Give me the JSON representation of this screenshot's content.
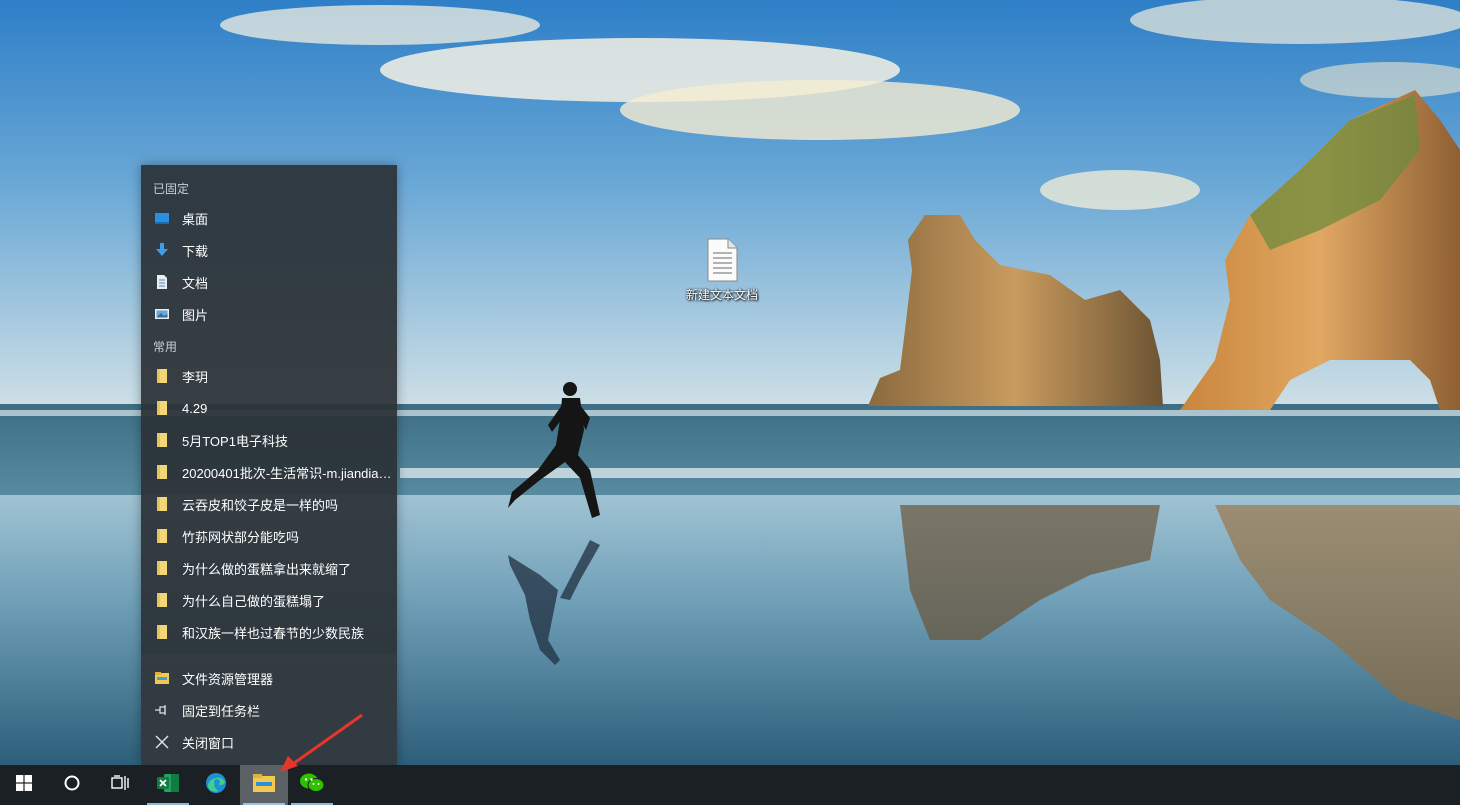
{
  "desktop": {
    "icons": [
      {
        "label": "新建文本文档",
        "icon": "text-document-icon"
      }
    ]
  },
  "jumplist": {
    "pinned_title": "已固定",
    "pinned": [
      {
        "label": "桌面",
        "icon": "desktop-icon"
      },
      {
        "label": "下载",
        "icon": "download-icon"
      },
      {
        "label": "文档",
        "icon": "documents-icon"
      },
      {
        "label": "图片",
        "icon": "pictures-icon"
      }
    ],
    "frequent_title": "常用",
    "frequent": [
      {
        "label": "李玥",
        "icon": "folder-icon"
      },
      {
        "label": "4.29",
        "icon": "folder-icon"
      },
      {
        "label": "5月TOP1电子科技",
        "icon": "folder-icon"
      },
      {
        "label": "20200401批次-生活常识-m.jiandiao....",
        "icon": "folder-icon"
      },
      {
        "label": "云吞皮和饺子皮是一样的吗",
        "icon": "folder-icon"
      },
      {
        "label": "竹荪网状部分能吃吗",
        "icon": "folder-icon"
      },
      {
        "label": "为什么做的蛋糕拿出来就缩了",
        "icon": "folder-icon"
      },
      {
        "label": "为什么自己做的蛋糕塌了",
        "icon": "folder-icon"
      },
      {
        "label": "和汉族一样也过春节的少数民族",
        "icon": "folder-icon"
      }
    ],
    "tasks": [
      {
        "label": "文件资源管理器",
        "icon": "file-explorer-icon"
      },
      {
        "label": "固定到任务栏",
        "icon": "pin-icon"
      },
      {
        "label": "关闭窗口",
        "icon": "close-icon"
      }
    ]
  },
  "taskbar": {
    "buttons": [
      {
        "name": "start",
        "icon": "windows-logo-icon"
      },
      {
        "name": "search",
        "icon": "cortana-circle-icon"
      },
      {
        "name": "task-view",
        "icon": "task-view-icon"
      },
      {
        "name": "excel",
        "icon": "excel-icon"
      },
      {
        "name": "edge",
        "icon": "edge-icon"
      },
      {
        "name": "file-explorer",
        "icon": "file-explorer-icon"
      },
      {
        "name": "wechat",
        "icon": "wechat-icon"
      }
    ]
  },
  "colors": {
    "jumplist_bg": "#2b3237",
    "taskbar_bg": "#1b2024",
    "folder_yellow": "#f3d675",
    "accent_blue": "#3a9ee8",
    "annotation_red": "#e8352a"
  }
}
